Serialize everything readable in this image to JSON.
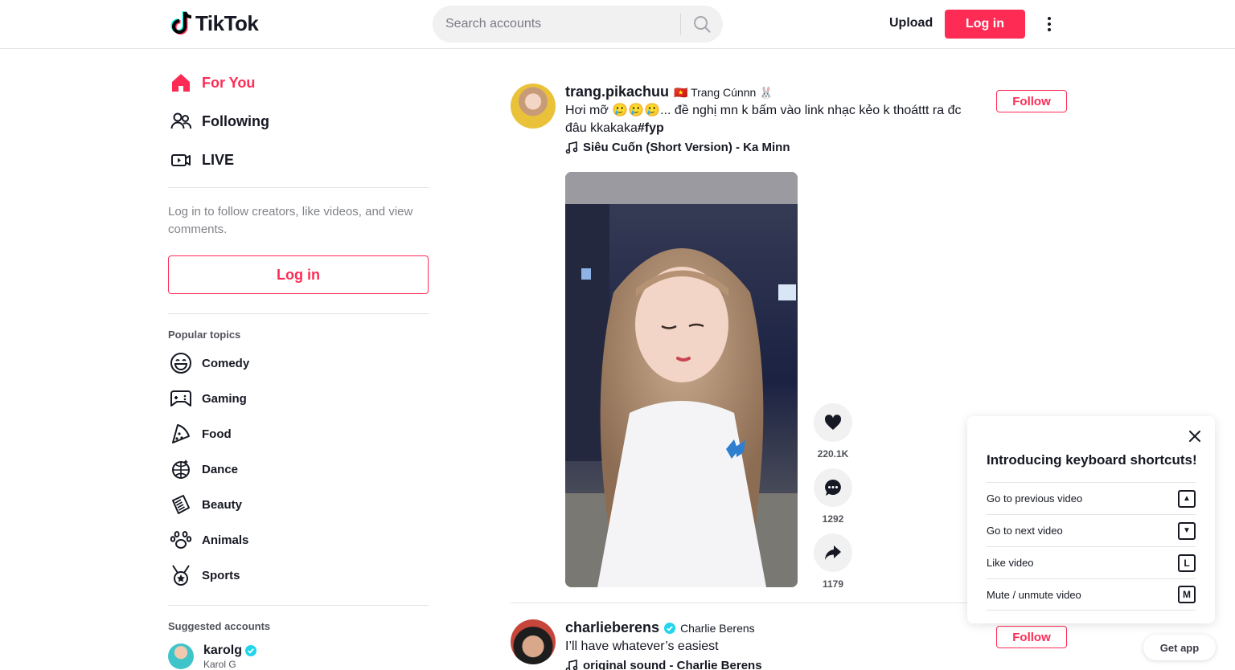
{
  "header": {
    "logo_text": "TikTok",
    "search_placeholder": "Search accounts",
    "upload_label": "Upload",
    "login_label": "Log in"
  },
  "sidebar": {
    "nav": [
      {
        "label": "For You",
        "icon": "home-icon",
        "active": true
      },
      {
        "label": "Following",
        "icon": "people-icon",
        "active": false
      },
      {
        "label": "LIVE",
        "icon": "live-icon",
        "active": false
      }
    ],
    "login_prompt": "Log in to follow creators, like videos, and view comments.",
    "login_label": "Log in",
    "popular_topics_title": "Popular topics",
    "topics": [
      {
        "label": "Comedy",
        "icon": "comedy-icon"
      },
      {
        "label": "Gaming",
        "icon": "gaming-icon"
      },
      {
        "label": "Food",
        "icon": "food-icon"
      },
      {
        "label": "Dance",
        "icon": "dance-icon"
      },
      {
        "label": "Beauty",
        "icon": "beauty-icon"
      },
      {
        "label": "Animals",
        "icon": "animals-icon"
      },
      {
        "label": "Sports",
        "icon": "sports-icon"
      }
    ],
    "suggested_title": "Suggested accounts",
    "suggested": [
      {
        "username": "karolg",
        "nickname": "Karol G",
        "verified": true
      }
    ]
  },
  "feed": [
    {
      "username": "trang.pikachuu",
      "nickname": "🇻🇳 Trang Cúnnn 🐰",
      "caption": "Hơi mỡ 🥲🥲🥲... đề nghị mn k bấm vào link nhạc kẻo k thoáttt ra đc đâu kkakaka",
      "hashtag": "#fyp",
      "music": "Siêu Cuốn (Short Version) - Ka Minn",
      "follow_label": "Follow",
      "likes": "220.1K",
      "comments": "1292",
      "shares": "1179"
    },
    {
      "username": "charlieberens",
      "nickname": "Charlie Berens",
      "verified": true,
      "caption": "I’ll have whatever’s easiest",
      "music": "original sound - Charlie Berens",
      "follow_label": "Follow"
    }
  ],
  "shortcuts": {
    "title": "Introducing keyboard shortcuts!",
    "items": [
      {
        "label": "Go to previous video",
        "key": "▲"
      },
      {
        "label": "Go to next video",
        "key": "▼"
      },
      {
        "label": "Like video",
        "key": "L"
      },
      {
        "label": "Mute / unmute video",
        "key": "M"
      }
    ]
  },
  "get_app_label": "Get app",
  "colors": {
    "brand": "#fe2c55",
    "verified": "#20d5ec",
    "text": "#161823"
  }
}
